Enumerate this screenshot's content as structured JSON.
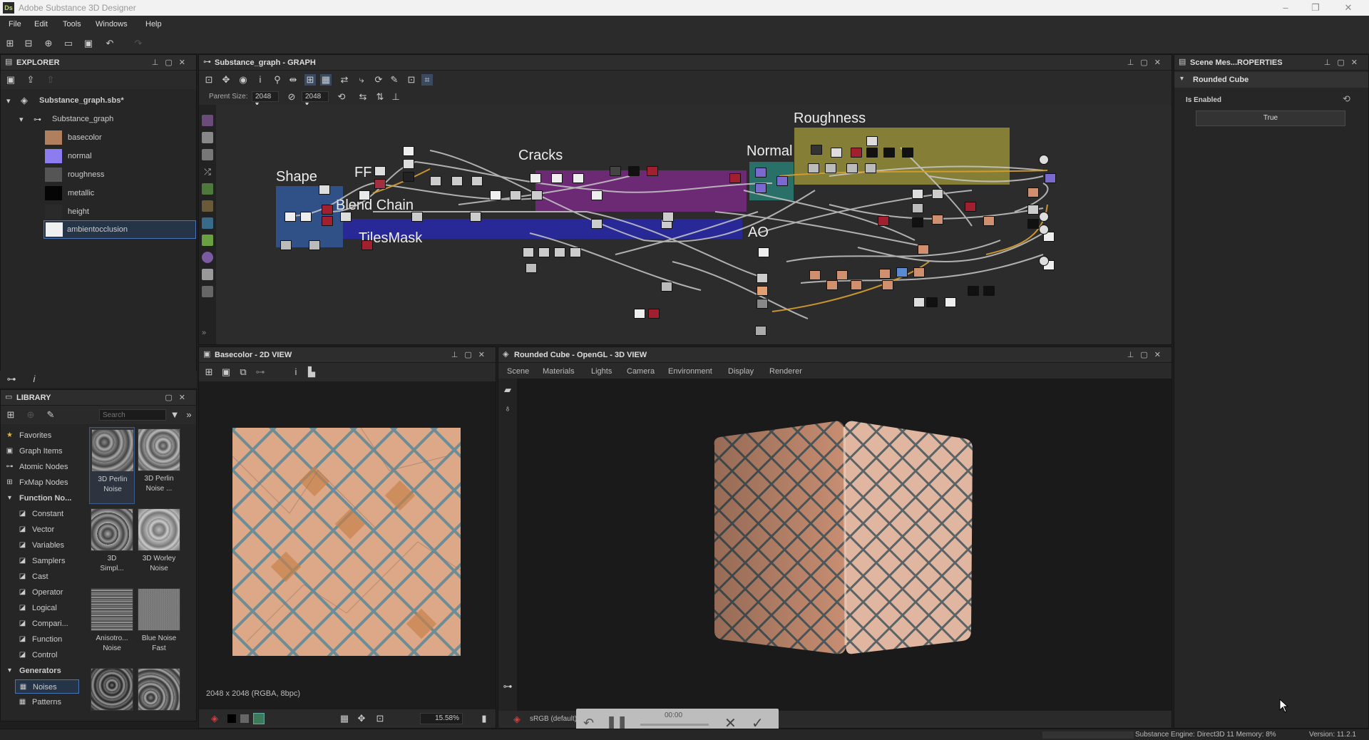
{
  "app": {
    "title": "Adobe Substance 3D Designer",
    "logo": "Ds"
  },
  "menu": [
    "File",
    "Edit",
    "Tools",
    "Windows",
    "Help"
  ],
  "explorer": {
    "title": "EXPLORER",
    "package": "Substance_graph.sbs*",
    "graph": "Substance_graph",
    "outputs": [
      {
        "label": "basecolor",
        "color": "#b08060"
      },
      {
        "label": "normal",
        "color": "#8c7cf0"
      },
      {
        "label": "roughness",
        "color": "#555555"
      },
      {
        "label": "metallic",
        "color": "#050505"
      },
      {
        "label": "height",
        "color": "#2a2a2a"
      },
      {
        "label": "ambientocclusion",
        "color": "#f0f0f0"
      }
    ]
  },
  "graph": {
    "title": "Substance_graph - GRAPH",
    "parent_size_label": "Parent Size:",
    "parent_size": "2048",
    "size": "2048",
    "frames": [
      "Roughness",
      "Cracks",
      "Normal",
      "Shape",
      "FF",
      "Blend Chain",
      "TilesMask",
      "AO"
    ]
  },
  "library": {
    "title": "LIBRARY",
    "search_placeholder": "Search",
    "categories": [
      "Favorites",
      "Graph Items",
      "Atomic Nodes",
      "FxMap Nodes",
      "Function No..."
    ],
    "function_items": [
      "Constant",
      "Vector",
      "Variables",
      "Samplers",
      "Cast",
      "Operator",
      "Logical",
      "Compari...",
      "Function",
      "Control"
    ],
    "generators": "Generators",
    "generator_items": [
      "Noises",
      "Patterns"
    ],
    "thumbnails": [
      {
        "label1": "3D Perlin",
        "label2": "Noise"
      },
      {
        "label1": "3D Perlin",
        "label2": "Noise ..."
      },
      {
        "label1": "3D",
        "label2": "Simpl..."
      },
      {
        "label1": "3D Worley",
        "label2": "Noise"
      },
      {
        "label1": "Anisotro...",
        "label2": "Noise"
      },
      {
        "label1": "Blue Noise",
        "label2": "Fast"
      }
    ]
  },
  "view2d": {
    "title": "Basecolor - 2D VIEW",
    "info": "2048 x 2048 (RGBA, 8bpc)",
    "zoom": "15.58%"
  },
  "view3d": {
    "title": "Rounded Cube - OpenGL - 3D VIEW",
    "tabs": [
      "Scene",
      "Materials",
      "Lights",
      "Camera",
      "Environment",
      "Display",
      "Renderer"
    ],
    "colorspace": "sRGB (default)"
  },
  "properties": {
    "title": "Scene Mes...ROPERTIES",
    "section": "Rounded Cube",
    "field_label": "Is Enabled",
    "field_value": "True"
  },
  "recorder": {
    "time": "00:00"
  },
  "statusbar": {
    "engine": "Substance Engine: Direct3D 11  Memory: 8%",
    "version": "Version: 11.2.1"
  }
}
